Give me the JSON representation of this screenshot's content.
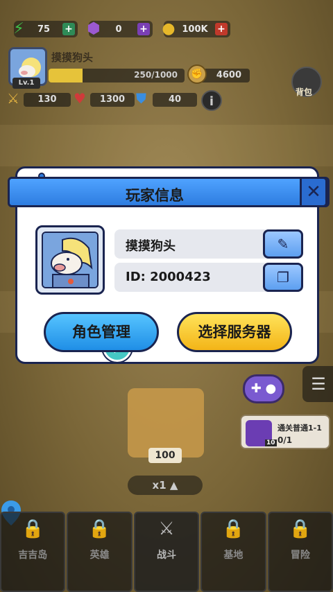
{
  "resources": [
    {
      "icon": "lightning-icon",
      "value": "75",
      "plus_color": "#2e8b57"
    },
    {
      "icon": "gem-icon",
      "value": "0",
      "plus_color": "#7a3fb5"
    },
    {
      "icon": "coin-icon",
      "value": "100K",
      "plus_color": "#c0392b"
    }
  ],
  "player": {
    "name": "摸摸狗头",
    "level": "Lv.1",
    "xp_text": "250/1000",
    "xp_fraction": 0.25,
    "power": "4600",
    "attack": "130",
    "hp": "1300",
    "defense": "40",
    "bag_label": "背包"
  },
  "modal": {
    "title": "玩家信息",
    "name_value": "摸摸狗头",
    "id_value": "ID: 2000423",
    "role_button": "角色管理",
    "server_button": "选择服务器"
  },
  "quest": {
    "title": "通关普通1-1",
    "progress": "0/1",
    "gem_count": "10"
  },
  "chest": {
    "count": "100",
    "multiplier": "x1"
  },
  "nav": [
    {
      "label": "吉吉岛",
      "icon": "lock-icon"
    },
    {
      "label": "英雄",
      "icon": "lock-icon"
    },
    {
      "label": "战斗",
      "icon": "crossed-swords-icon"
    },
    {
      "label": "基地",
      "icon": "lock-icon"
    },
    {
      "label": "冒险",
      "icon": "lock-icon"
    }
  ],
  "colors": {
    "modal_header": "#2e7de0",
    "role_button": "#1f8ee6",
    "server_button": "#f3b417",
    "outline": "#1a2450"
  }
}
